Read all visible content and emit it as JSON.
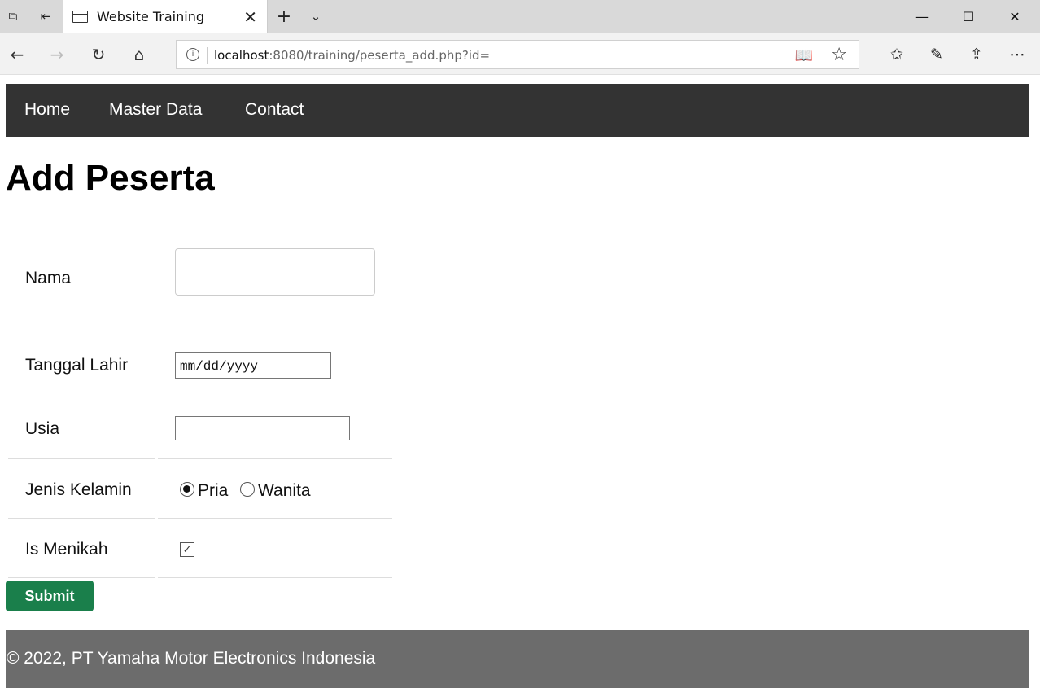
{
  "browser": {
    "tab_title": "Website Training",
    "url_host": "localhost",
    "url_rest": ":8080/training/peserta_add.php?id="
  },
  "site_nav": {
    "items": [
      "Home",
      "Master Data",
      "Contact"
    ]
  },
  "page_title": "Add Peserta",
  "form": {
    "nama_label": "Nama",
    "nama_value": "",
    "tanggal_label": "Tanggal Lahir",
    "tanggal_placeholder": "mm/dd/yyyy",
    "usia_label": "Usia",
    "usia_value": "",
    "jenis_kelamin_label": "Jenis Kelamin",
    "gender_options": [
      "Pria",
      "Wanita"
    ],
    "gender_selected": "Pria",
    "menikah_label": "Is Menikah",
    "menikah_checked": true,
    "submit_label": "Submit"
  },
  "footer": {
    "text": "© 2022, PT Yamaha Motor Electronics Indonesia"
  },
  "colors": {
    "nav_bg": "#333333",
    "submit_bg": "#1a7f4b",
    "footer_bg": "#6c6c6c"
  }
}
